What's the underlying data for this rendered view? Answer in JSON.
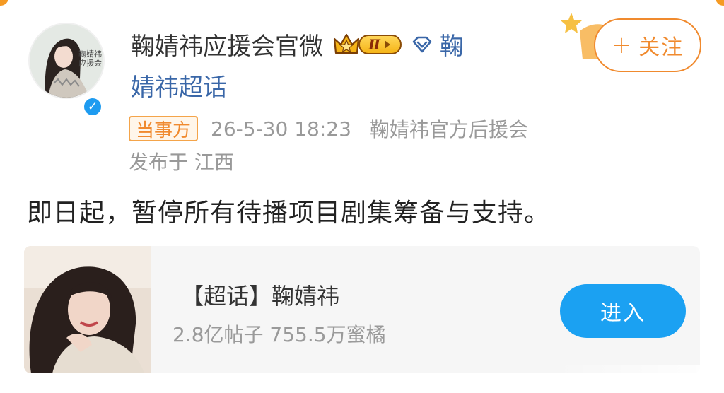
{
  "author": {
    "name": "鞠婧祎应援会官微",
    "avatar_caption": "鞠婧祎\n应援会",
    "rank_label": "Ⅱ",
    "topic_link_part1": "鞠",
    "topic_link_part2": "婧祎超话"
  },
  "follow_button": {
    "plus": "+",
    "label": "关注"
  },
  "meta": {
    "party_tag": "当事方",
    "time": "26-5-30 18:23",
    "source": "鞠婧祎官方后援会",
    "location": "发布于 江西"
  },
  "post": {
    "text": "即日起，暂停所有待播项目剧集筹备与支持。"
  },
  "topic_card": {
    "title": "【超话】鞠婧祎",
    "stats": "2.8亿帖子 755.5万蜜橘",
    "enter_label": "进入"
  },
  "colors": {
    "accent_orange": "#f08a2e",
    "link_blue": "#3a67a8",
    "button_blue": "#1ba1f2",
    "verified_blue": "#1e9bf0"
  }
}
